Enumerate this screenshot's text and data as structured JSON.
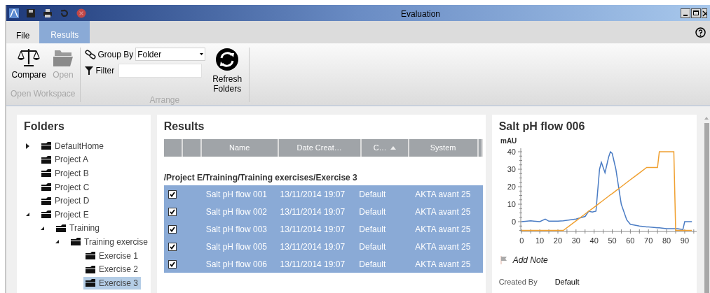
{
  "window": {
    "title": "Evaluation"
  },
  "menu_tabs": [
    {
      "label": "File",
      "selected": false
    },
    {
      "label": "Results",
      "selected": true
    }
  ],
  "ribbon": {
    "groups": [
      {
        "title": "Open Workspace",
        "buttons": [
          {
            "label": "Compare",
            "kind": "compare",
            "disabled": false
          },
          {
            "label": "Open",
            "kind": "open",
            "disabled": true
          }
        ]
      },
      {
        "title": "Arrange",
        "group_by": {
          "label": "Group By",
          "value": "Folder"
        },
        "filter": {
          "label": "Filter"
        },
        "buttons": [
          {
            "label": "Refresh Folders",
            "kind": "refresh",
            "disabled": false
          }
        ]
      }
    ]
  },
  "folders": {
    "title": "Folders",
    "items": [
      {
        "label": "DefaultHome",
        "expanded": false,
        "selected": false
      },
      {
        "label": "Project A",
        "selected": false
      },
      {
        "label": "Project B",
        "selected": false
      },
      {
        "label": "Project C",
        "selected": false
      },
      {
        "label": "Project D",
        "selected": false
      },
      {
        "label": "Project E",
        "expanded": true,
        "selected": false,
        "children": [
          {
            "label": "Training",
            "expanded": true,
            "selected": false,
            "children": [
              {
                "label": "Training exercise",
                "expanded": true,
                "selected": false,
                "children": [
                  {
                    "label": "Exercise 1",
                    "selected": false
                  },
                  {
                    "label": "Exercise 2",
                    "selected": false
                  },
                  {
                    "label": "Exercise 3",
                    "selected": true
                  }
                ]
              }
            ]
          }
        ]
      }
    ]
  },
  "results": {
    "title": "Results",
    "columns": [
      {
        "label": "Name"
      },
      {
        "label": "Date Creat…"
      },
      {
        "label": "C…",
        "sorted": true
      },
      {
        "label": "System"
      }
    ],
    "group": "/Project E/Training/Training exercises/Exercise 3",
    "rows": [
      {
        "checked": true,
        "selected": true,
        "cells": [
          "Salt pH flow 001",
          "13/11/2014 19:07",
          "Default",
          "AKTA avant 25"
        ]
      },
      {
        "checked": true,
        "selected": true,
        "cells": [
          "Salt pH flow 002",
          "13/11/2014 19:07",
          "Default",
          "AKTA avant 25"
        ]
      },
      {
        "checked": true,
        "selected": true,
        "cells": [
          "Salt pH flow 003",
          "13/11/2014 19:07",
          "Default",
          "AKTA avant 25"
        ]
      },
      {
        "checked": true,
        "selected": true,
        "cells": [
          "Salt pH flow 005",
          "13/11/2014 19:07",
          "Default",
          "AKTA avant 25"
        ]
      },
      {
        "checked": true,
        "selected": true,
        "cells": [
          "Salt pH flow 006",
          "13/11/2014 19:07",
          "Default",
          "AKTA avant 25"
        ]
      }
    ]
  },
  "detail": {
    "title": "Salt pH flow 006",
    "chart_data": {
      "type": "line",
      "ylabel": "mAU",
      "x": [
        0,
        5,
        10,
        13,
        15,
        20,
        23,
        30,
        35,
        37,
        39,
        41,
        43,
        44,
        46,
        48,
        49,
        50,
        52,
        55,
        58,
        60,
        65,
        69,
        70,
        75,
        76,
        80,
        84,
        85,
        86,
        89,
        90,
        94
      ],
      "series": [
        {
          "color": "#4a7cc4",
          "values": [
            0,
            0.5,
            0,
            1.5,
            0.3,
            0.3,
            0.5,
            1.5,
            3,
            6,
            5.5,
            6,
            30,
            34,
            28,
            37,
            40,
            39,
            30,
            10,
            1,
            -1.5,
            -2.5,
            -3,
            -3,
            -3.5,
            -3.5,
            -4,
            -4,
            -4,
            -4,
            -4.5,
            0,
            0
          ]
        },
        {
          "color": "#f0a030",
          "values": [
            -5,
            -5,
            -5,
            -5,
            -5,
            -5,
            -5,
            0.5,
            4.4,
            6,
            7.5,
            9.1,
            10.7,
            11.4,
            13,
            14.6,
            15.4,
            16.1,
            17.7,
            20,
            22.4,
            24,
            27.9,
            31,
            31,
            31,
            40,
            40,
            40,
            -5,
            -5,
            -5,
            -5,
            -5
          ]
        }
      ],
      "xticks": [
        0,
        10,
        20,
        30,
        40,
        50,
        60,
        70,
        80,
        90
      ],
      "yticks": [
        0,
        10,
        20,
        30,
        40
      ],
      "xlim": [
        -0.5,
        97
      ],
      "ylim": [
        -5.6,
        42
      ]
    },
    "add_note": "Add Note",
    "fields": [
      {
        "label": "Created By",
        "value": "Default"
      }
    ]
  }
}
